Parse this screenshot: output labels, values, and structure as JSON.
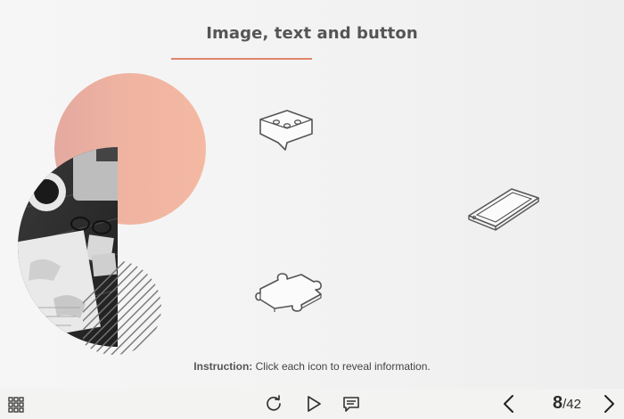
{
  "slide": {
    "title": "Image, text and button",
    "instruction_label": "Instruction:",
    "instruction_text": " Click each icon to reveal information."
  },
  "hotspots": [
    {
      "icon": "chat-bubble-icon"
    },
    {
      "icon": "smartphone-icon"
    },
    {
      "icon": "puzzle-piece-icon"
    }
  ],
  "controls": {
    "menu_icon": "grid-menu-icon",
    "replay_icon": "replay-icon",
    "play_icon": "play-icon",
    "comment_icon": "comment-icon",
    "prev_icon": "chevron-left-icon",
    "next_icon": "chevron-right-icon"
  },
  "pagination": {
    "current": "8",
    "total": "/42"
  },
  "colors": {
    "accent": "#e0866b",
    "peach": "#f1b4a1"
  }
}
